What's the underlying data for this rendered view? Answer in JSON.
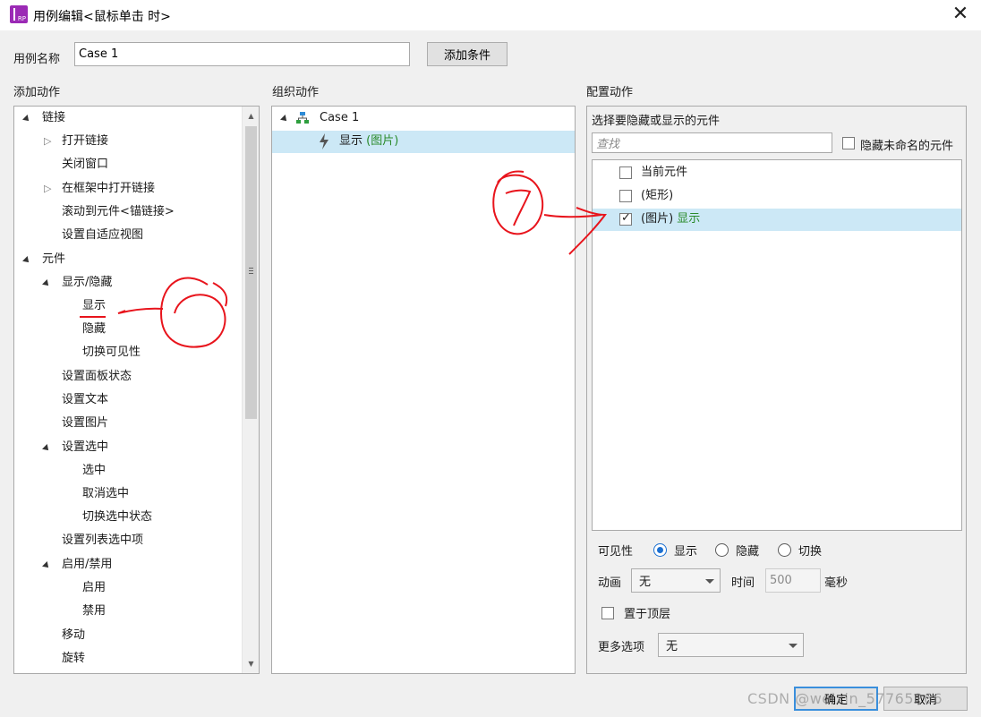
{
  "window": {
    "title": "用例编辑<鼠标单击 时>",
    "app_icon_text": "RP",
    "close_glyph": "✕"
  },
  "case_name": {
    "label": "用例名称",
    "value": "Case 1",
    "add_condition_button": "添加条件"
  },
  "add_action": {
    "header": "添加动作",
    "items": [
      {
        "label": "链接"
      },
      {
        "label": "打开链接"
      },
      {
        "label": "关闭窗口"
      },
      {
        "label": "在框架中打开链接"
      },
      {
        "label": "滚动到元件<锚链接>"
      },
      {
        "label": "设置自适应视图"
      },
      {
        "label": "元件"
      },
      {
        "label": "显示/隐藏"
      },
      {
        "label": "显示"
      },
      {
        "label": "隐藏"
      },
      {
        "label": "切换可见性"
      },
      {
        "label": "设置面板状态"
      },
      {
        "label": "设置文本"
      },
      {
        "label": "设置图片"
      },
      {
        "label": "设置选中"
      },
      {
        "label": "选中"
      },
      {
        "label": "取消选中"
      },
      {
        "label": "切换选中状态"
      },
      {
        "label": "设置列表选中项"
      },
      {
        "label": "启用/禁用"
      },
      {
        "label": "启用"
      },
      {
        "label": "禁用"
      },
      {
        "label": "移动"
      },
      {
        "label": "旋转"
      }
    ]
  },
  "organize_action": {
    "header": "组织动作",
    "case_label": "Case 1",
    "action_label": "显示",
    "action_target": "(图片)"
  },
  "configure_action": {
    "header": "配置动作",
    "prompt": "选择要隐藏或显示的元件",
    "search_placeholder": "查找",
    "hide_unnamed_label": "隐藏未命名的元件",
    "widgets": [
      {
        "label": "当前元件",
        "checked": false,
        "status": ""
      },
      {
        "label": "(矩形)",
        "checked": false,
        "status": ""
      },
      {
        "label": "(图片)",
        "checked": true,
        "status": "显示"
      }
    ],
    "visibility": {
      "label": "可见性",
      "options": [
        "显示",
        "隐藏",
        "切换"
      ],
      "selected": "显示"
    },
    "animation": {
      "label": "动画",
      "value": "无",
      "time_label": "时间",
      "time_value": "500",
      "unit": "毫秒"
    },
    "bring_to_front_label": "置于顶层",
    "more_options": {
      "label": "更多选项",
      "value": "无"
    }
  },
  "footer": {
    "ok_button": "确定",
    "cancel_button": "取消",
    "watermark": "CSDN @weixin_57765266"
  },
  "annotations": {
    "mark_6": "6",
    "mark_7": "7"
  },
  "colors": {
    "dialog_bg": "#f0f0f0",
    "selection": "#cce8f6",
    "green_status": "#2a8a2a",
    "ink_red": "#e8141c",
    "radio_accent": "#1a6fd1"
  }
}
